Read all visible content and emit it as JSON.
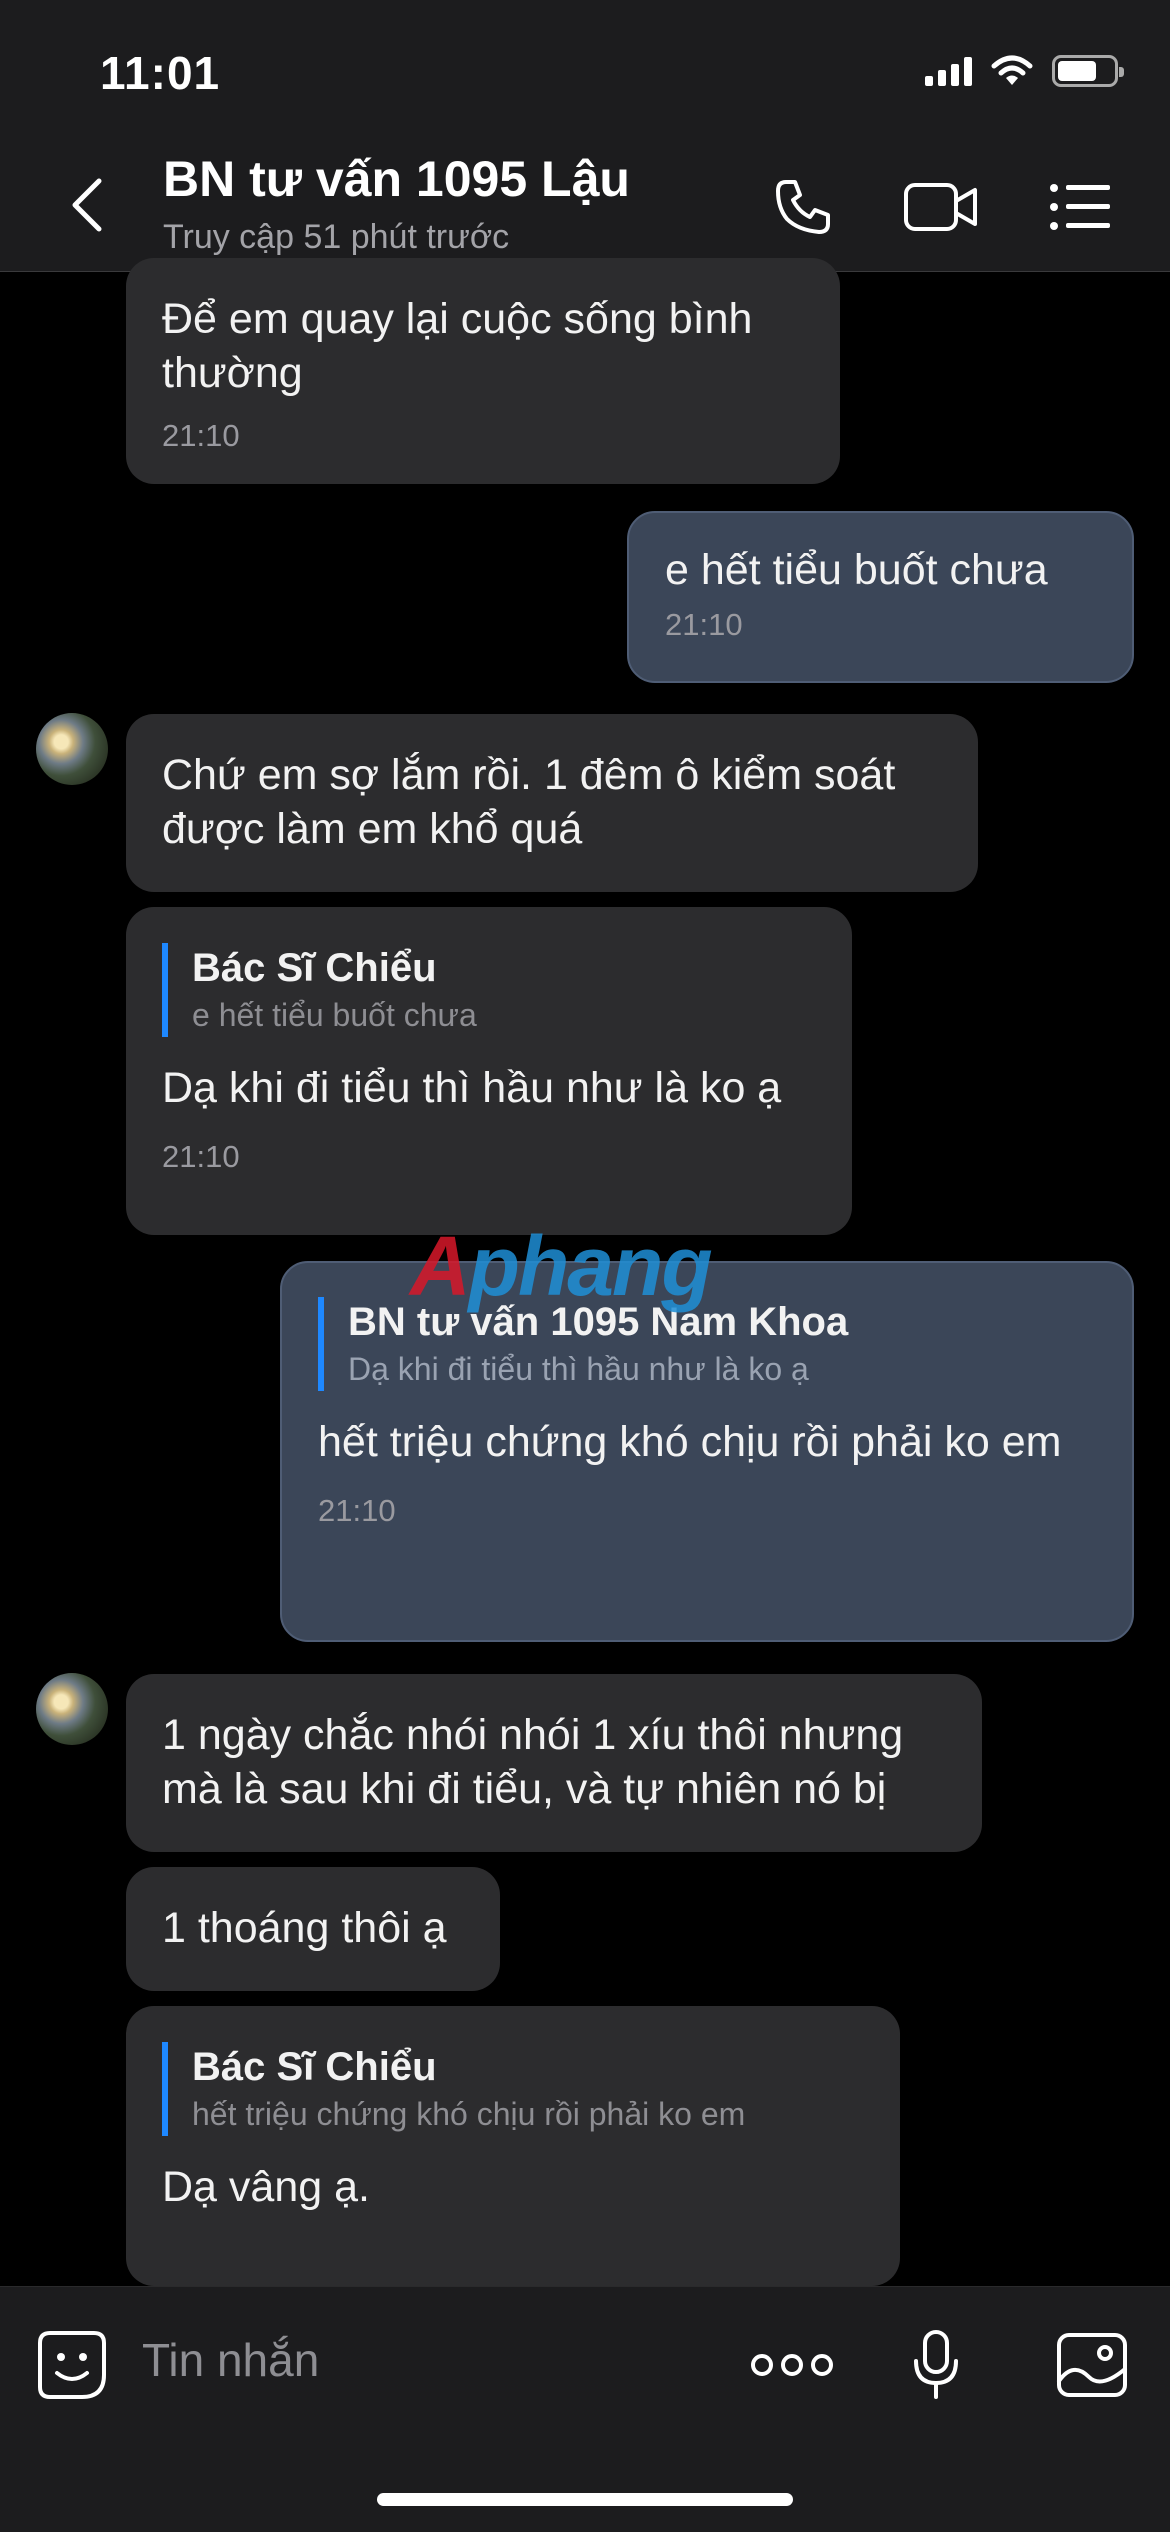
{
  "status_bar": {
    "time": "11:01"
  },
  "header": {
    "title": "BN tư vấn 1095 Lậu",
    "subtitle": "Truy cập 51 phút trước",
    "icons": [
      "back-chevron-icon",
      "phone-icon",
      "video-camera-icon",
      "menu-list-icon"
    ]
  },
  "messages": [
    {
      "side": "received",
      "text": "Để em quay lại cuộc sống bình thường",
      "time": "21:10"
    },
    {
      "side": "sent",
      "text": "e hết  tiểu buốt  chưa",
      "time": "21:10"
    },
    {
      "side": "received",
      "text": "Chứ em sợ lắm rồi. 1 đêm ô kiểm soát được làm em khổ quá"
    },
    {
      "side": "received",
      "quote": {
        "name": "Bác Sĩ Chiểu",
        "text": "e hết  tiểu buốt  chưa"
      },
      "text": "Dạ khi đi tiểu thì hầu như là ko ạ",
      "time": "21:10"
    },
    {
      "side": "sent",
      "quote": {
        "name": "BN tư vấn 1095 Nam Khoa",
        "text": "Dạ khi đi tiểu thì hầu như là ko ạ"
      },
      "text": "hết triệu  chứng khó  chịu  rồi phải ko em",
      "time": "21:10"
    },
    {
      "side": "received",
      "text": "1 ngày chắc nhói nhói 1 xíu thôi nhưng mà là sau khi đi tiểu, và tự nhiên nó bị"
    },
    {
      "side": "received",
      "text": "1 thoáng thôi ạ"
    },
    {
      "side": "received",
      "quote": {
        "name": "Bác Sĩ Chiểu",
        "text": "hết triệu  chứng khó  chịu  rồi phải ko  em"
      },
      "text": "Dạ vâng ạ."
    }
  ],
  "watermark": {
    "part1": "A",
    "part2": "phang"
  },
  "composer": {
    "placeholder": "Tin nhắn",
    "icons": [
      "emoji-sticker-icon",
      "more-options-icon",
      "microphone-icon",
      "image-gallery-icon"
    ]
  },
  "colors": {
    "header_bg": "#1c1c1e",
    "received_bubble": "#2c2c2e",
    "sent_bubble": "#3b4658",
    "quote_bar": "#1e88ff"
  }
}
